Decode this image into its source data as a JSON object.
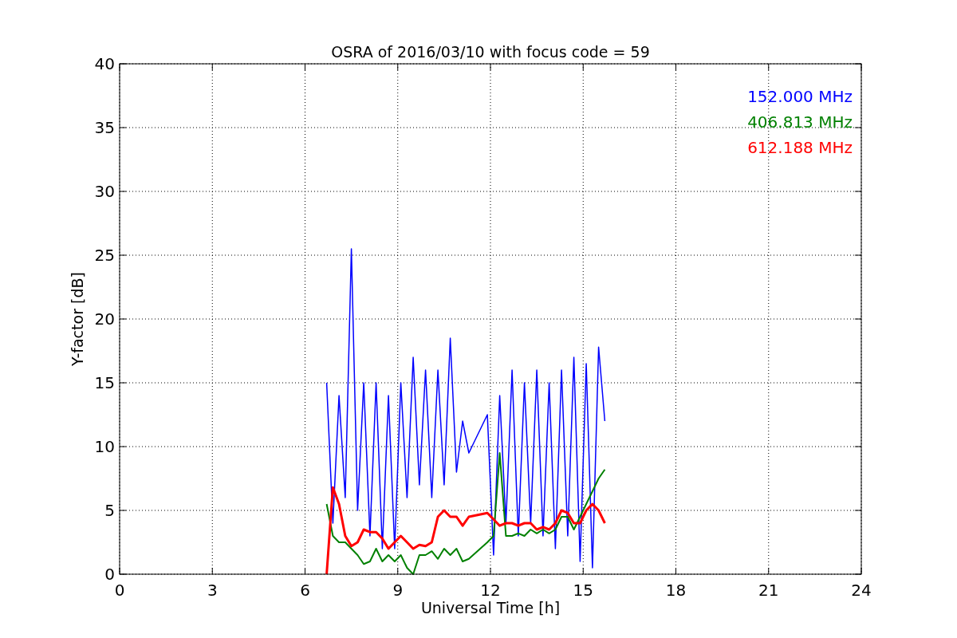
{
  "chart_data": {
    "type": "line",
    "title": "OSRA of 2016/03/10 with focus code = 59",
    "xlabel": "Universal Time [h]",
    "ylabel": "Y-factor [dB]",
    "x": [
      6.7,
      6.9,
      7.1,
      7.3,
      7.5,
      7.7,
      7.9,
      8.1,
      8.3,
      8.5,
      8.7,
      8.9,
      9.1,
      9.3,
      9.5,
      9.7,
      9.9,
      10.1,
      10.3,
      10.5,
      10.7,
      10.9,
      11.1,
      11.3,
      11.9,
      12.1,
      12.3,
      12.5,
      12.7,
      12.9,
      13.1,
      13.3,
      13.5,
      13.7,
      13.9,
      14.1,
      14.3,
      14.5,
      14.7,
      14.9,
      15.1,
      15.3,
      15.5,
      15.7
    ],
    "series": [
      {
        "name": "152.000 MHz",
        "color": "#0000ff",
        "values": [
          15,
          4,
          14,
          6,
          25.5,
          5,
          15,
          3,
          15,
          2,
          14,
          2,
          15,
          6,
          17,
          7,
          16,
          6,
          16,
          7,
          18.5,
          8,
          12,
          9.5,
          12.5,
          1.5,
          14,
          4,
          16,
          3,
          15,
          4,
          16,
          3,
          15,
          2,
          16,
          3,
          17,
          1,
          16.5,
          0.5,
          17.8,
          12
        ]
      },
      {
        "name": "406.813 MHz",
        "color": "#008000",
        "values": [
          5.5,
          3,
          2.5,
          2.5,
          2,
          1.5,
          0.8,
          1,
          2,
          1,
          1.5,
          1,
          1.5,
          0.5,
          0,
          1.5,
          1.5,
          1.8,
          1.2,
          2,
          1.5,
          2,
          1,
          1.2,
          2.5,
          3,
          9.5,
          3,
          3,
          3.2,
          3,
          3.5,
          3.2,
          3.5,
          3.2,
          3.5,
          4.5,
          4.5,
          3.5,
          4.5,
          5.5,
          6.5,
          7.5,
          8.2
        ]
      },
      {
        "name": "612.188 MHz",
        "color": "#ff0000",
        "values": [
          0,
          6.8,
          5.5,
          3,
          2.2,
          2.5,
          3.5,
          3.3,
          3.3,
          2.8,
          2,
          2.5,
          3,
          2.5,
          2,
          2.3,
          2.2,
          2.5,
          4.5,
          5,
          4.5,
          4.5,
          3.8,
          4.5,
          4.8,
          4.3,
          3.8,
          4,
          4,
          3.8,
          4,
          4,
          3.5,
          3.7,
          3.5,
          4,
          5,
          4.8,
          4,
          4,
          5,
          5.5,
          5,
          4
        ]
      }
    ],
    "xlim": [
      0,
      24
    ],
    "ylim": [
      0,
      40
    ],
    "xticks": [
      0,
      3,
      6,
      9,
      12,
      15,
      18,
      21,
      24
    ],
    "yticks": [
      0,
      5,
      10,
      15,
      20,
      25,
      30,
      35,
      40
    ],
    "grid": true
  }
}
